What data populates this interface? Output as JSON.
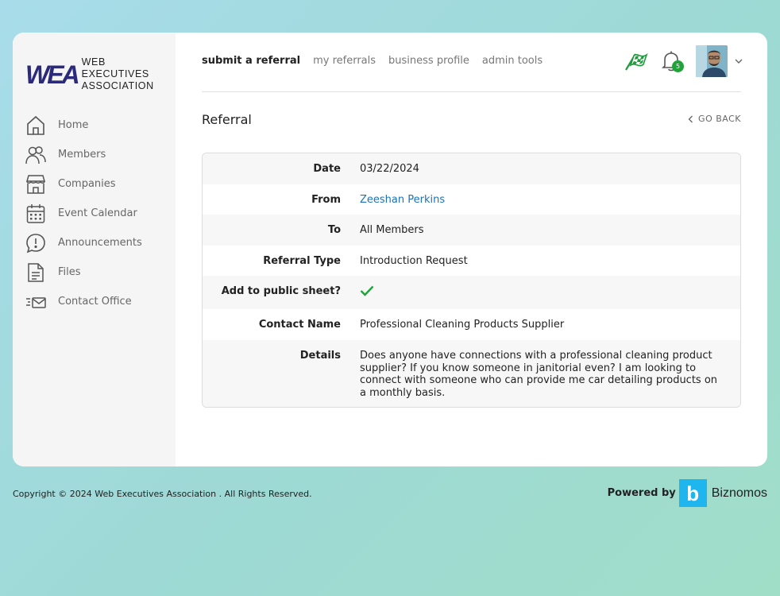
{
  "logo": {
    "mark": "WEA",
    "line1": "WEB EXECUTIVES",
    "line2": "ASSOCIATION"
  },
  "sidebar": {
    "items": [
      {
        "label": "Home",
        "icon": "home-icon"
      },
      {
        "label": "Members",
        "icon": "members-icon"
      },
      {
        "label": "Companies",
        "icon": "store-icon"
      },
      {
        "label": "Event Calendar",
        "icon": "calendar-icon"
      },
      {
        "label": "Announcements",
        "icon": "announcement-icon"
      },
      {
        "label": "Files",
        "icon": "file-icon"
      },
      {
        "label": "Contact Office",
        "icon": "mail-icon"
      }
    ]
  },
  "topnav": {
    "tabs": [
      {
        "label": "submit a referral",
        "active": true
      },
      {
        "label": "my referrals"
      },
      {
        "label": "business profile"
      },
      {
        "label": "admin tools"
      }
    ]
  },
  "header": {
    "notification_count": "5"
  },
  "page": {
    "title": "Referral",
    "go_back": "GO BACK"
  },
  "referral": {
    "date_label": "Date",
    "date": "03/22/2024",
    "from_label": "From",
    "from": "Zeeshan Perkins",
    "to_label": "To",
    "to": "All Members",
    "type_label": "Referral Type",
    "type": "Introduction Request",
    "public_label": "Add to public sheet?",
    "public": true,
    "contact_label": "Contact Name",
    "contact": "Professional Cleaning Products Supplier",
    "details_label": "Details",
    "details": "Does anyone have connections with a professional cleaning product supplier? If you know someone in janitorial even? I am looking to connect with someone who can provide me car detailing products on a monthly basis."
  },
  "footer": {
    "copyright": "Copyright © 2024 Web Executives Association . All Rights Reserved.",
    "powered_by": "Powered by",
    "brand_letter": "b",
    "brand_name": "Biznomos"
  },
  "colors": {
    "accent_green": "#22a33a",
    "link_blue": "#1a73b8",
    "logo_navy": "#2b2a7a",
    "brand_blue": "#1fb6f0"
  }
}
